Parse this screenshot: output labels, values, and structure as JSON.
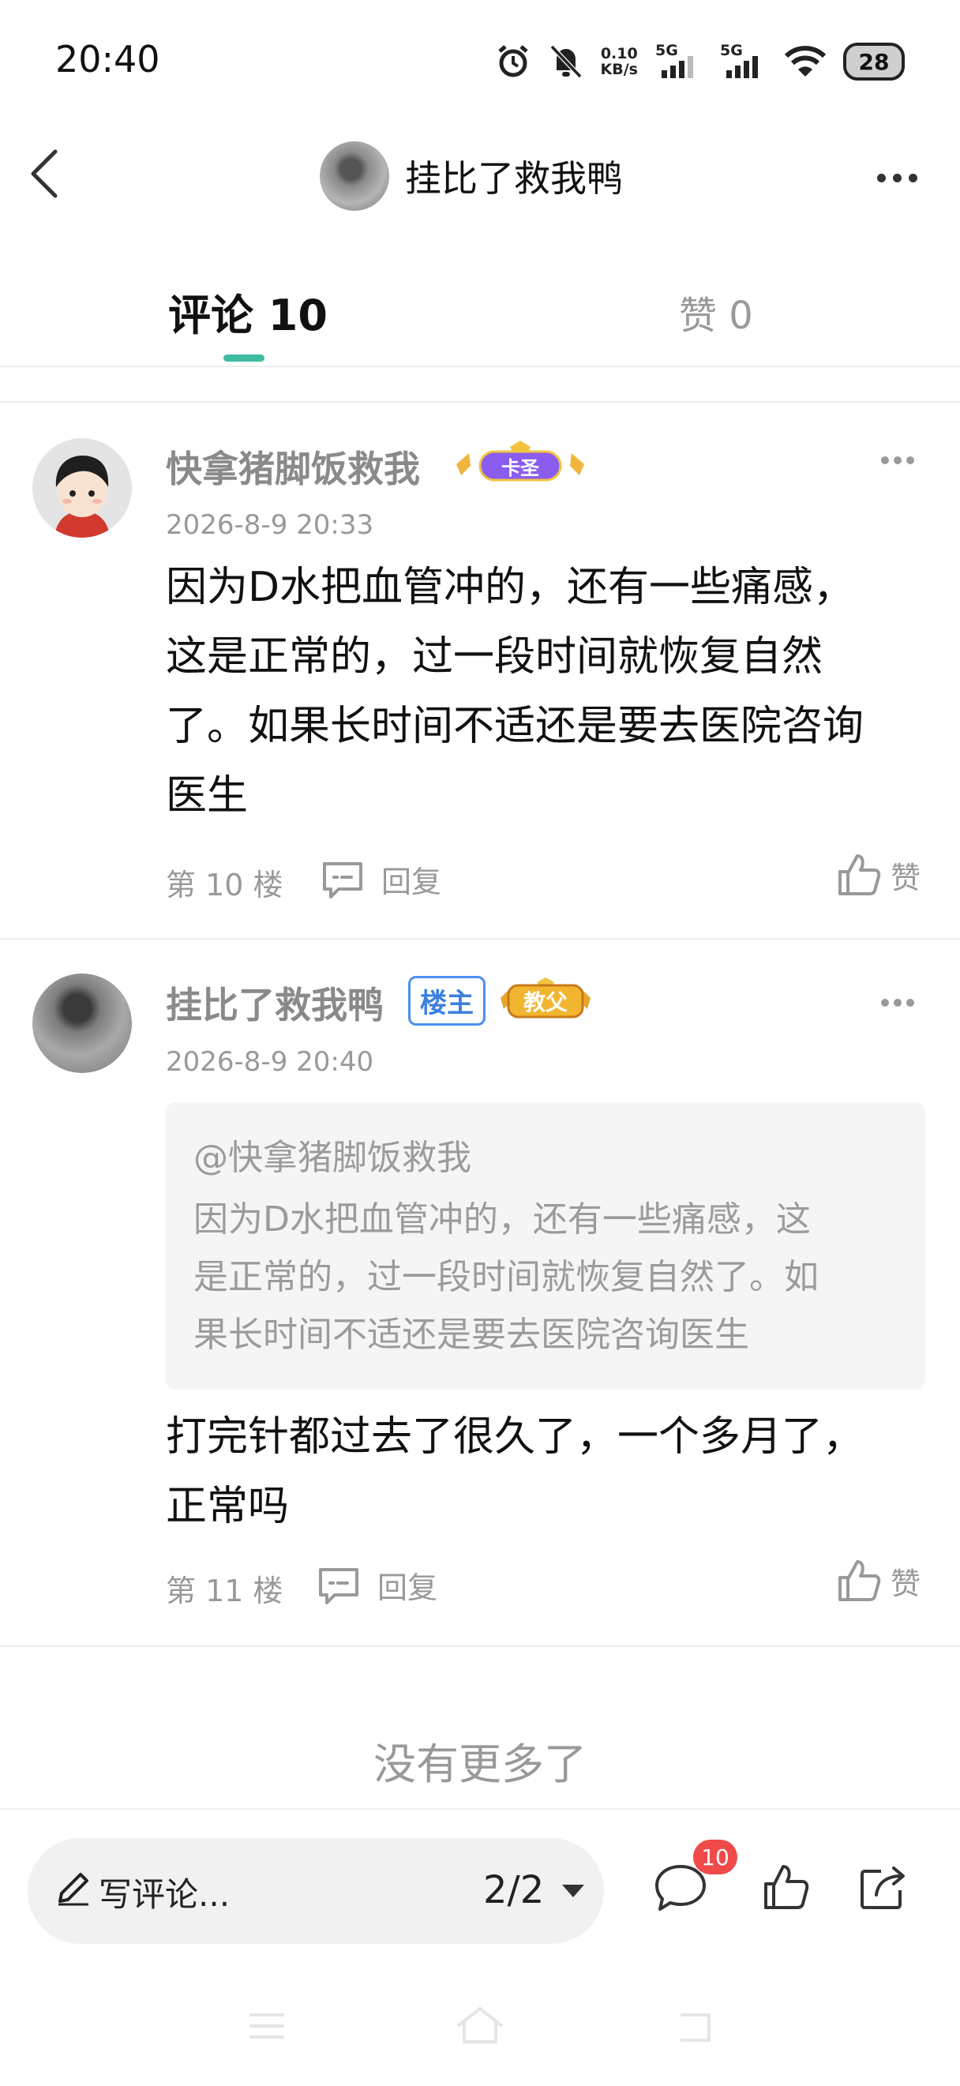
{
  "status_bar": {
    "time": "20:40",
    "net_speed_value": "0.10",
    "net_speed_unit": "KB/s",
    "sim1": "5G",
    "sim2": "5G",
    "battery": "28",
    "icons": [
      "alarm-icon",
      "mute-icon",
      "signal-icon",
      "wifi-icon",
      "battery-icon"
    ]
  },
  "header": {
    "title": "挂比了救我鸭",
    "back_icon": "chevron-left-icon",
    "more_icon": "more-horizontal-icon"
  },
  "tabs": {
    "comments_label": "评论 10",
    "likes_label": "赞 0",
    "accent": "#3ebba0"
  },
  "comments": [
    {
      "username": "快拿猪脚饭救我",
      "badge": "卡圣",
      "date": "2026-8-9 20:33",
      "text_lines": [
        "因为D水把血管冲的，还有一些痛感，",
        "这是正常的，过一段时间就恢复自然",
        "了。如果长时间不适还是要去医院咨询",
        "医生"
      ],
      "floor": "第 10 楼",
      "reply_label": "回复",
      "like_label": "赞"
    },
    {
      "username": "挂比了救我鸭",
      "owner_badge": "楼主",
      "badge": "教父",
      "date": "2026-8-9 20:40",
      "quote_user": "@快拿猪脚饭救我",
      "quote_lines": [
        "因为D水把血管冲的，还有一些痛感，这",
        "是正常的，过一段时间就恢复自然了。如",
        "果长时间不适还是要去医院咨询医生"
      ],
      "text_lines": [
        "打完针都过去了很久了，一个多月了，",
        "正常吗"
      ],
      "floor": "第 11 楼",
      "reply_label": "回复",
      "like_label": "赞"
    }
  ],
  "footer_text": "没有更多了",
  "bottom_bar": {
    "write_placeholder": "写评论...",
    "page_indicator": "2/2",
    "comment_count": "10",
    "icons": [
      "edit-icon",
      "comment-icon",
      "like-icon",
      "share-icon"
    ]
  }
}
